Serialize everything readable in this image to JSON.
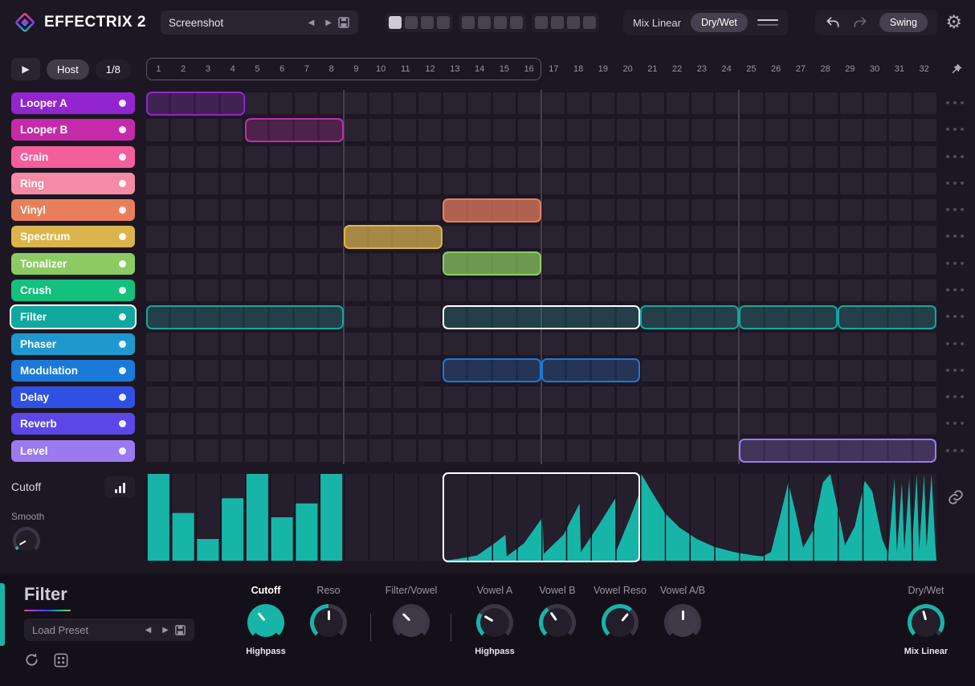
{
  "app": {
    "title": "EFFECTRIX 2"
  },
  "topbar": {
    "preset_name": "Screenshot",
    "pattern_slots": 12,
    "active_pattern": 1,
    "mix_label": "Mix Linear",
    "drywet_label": "Dry/Wet",
    "swing_label": "Swing"
  },
  "transport": {
    "host_label": "Host",
    "rate_label": "1/8"
  },
  "sequencer": {
    "steps": 32,
    "loop_steps": 16,
    "tracks": [
      {
        "name": "Looper A",
        "color": "#9325cf"
      },
      {
        "name": "Looper B",
        "color": "#c52ba8"
      },
      {
        "name": "Grain",
        "color": "#f55e9d"
      },
      {
        "name": "Ring",
        "color": "#f28ba3"
      },
      {
        "name": "Vinyl",
        "color": "#e87e5c"
      },
      {
        "name": "Spectrum",
        "color": "#dcb44c"
      },
      {
        "name": "Tonalizer",
        "color": "#8ccb61"
      },
      {
        "name": "Crush",
        "color": "#13c07c"
      },
      {
        "name": "Filter",
        "color": "#10a89e",
        "selected": true
      },
      {
        "name": "Phaser",
        "color": "#1f98cf"
      },
      {
        "name": "Modulation",
        "color": "#1b79da"
      },
      {
        "name": "Delay",
        "color": "#2f50e2"
      },
      {
        "name": "Reverb",
        "color": "#5b46e8"
      },
      {
        "name": "Level",
        "color": "#9b7af0"
      }
    ],
    "blocks": [
      {
        "track": 0,
        "start": 1,
        "end": 4,
        "fill": "dim"
      },
      {
        "track": 1,
        "start": 5,
        "end": 8,
        "fill": "dim"
      },
      {
        "track": 4,
        "start": 13,
        "end": 16,
        "fill": "solid"
      },
      {
        "track": 5,
        "start": 9,
        "end": 12,
        "fill": "solid"
      },
      {
        "track": 6,
        "start": 13,
        "end": 16,
        "fill": "solid"
      },
      {
        "track": 8,
        "start": 1,
        "end": 8,
        "fill": "dim"
      },
      {
        "track": 8,
        "start": 13,
        "end": 20,
        "fill": "dim",
        "selected": true
      },
      {
        "track": 8,
        "start": 21,
        "end": 24,
        "fill": "dim"
      },
      {
        "track": 8,
        "start": 25,
        "end": 28,
        "fill": "dim"
      },
      {
        "track": 8,
        "start": 29,
        "end": 32,
        "fill": "dim"
      },
      {
        "track": 10,
        "start": 13,
        "end": 16,
        "fill": "dim"
      },
      {
        "track": 10,
        "start": 17,
        "end": 20,
        "fill": "dim"
      },
      {
        "track": 13,
        "start": 25,
        "end": 32,
        "fill": "dim"
      }
    ]
  },
  "automation": {
    "param_label": "Cutoff",
    "smooth_label": "Smooth",
    "color": "#17b5a8",
    "selection": {
      "start": 13,
      "end": 20
    },
    "smooth_knob": {
      "value_deg": -120,
      "arc": 0.05
    },
    "bars": [
      {
        "step": 1,
        "h": 1.0
      },
      {
        "step": 2,
        "h": 0.55
      },
      {
        "step": 3,
        "h": 0.25
      },
      {
        "step": 4,
        "h": 0.72
      },
      {
        "step": 5,
        "h": 1.0
      },
      {
        "step": 6,
        "h": 0.5
      },
      {
        "step": 7,
        "h": 0.66
      },
      {
        "step": 8,
        "h": 1.0
      }
    ],
    "curve": [
      [
        12.05,
        0
      ],
      [
        12.6,
        0.02
      ],
      [
        13.4,
        0.06
      ],
      [
        14.2,
        0.22
      ],
      [
        14.55,
        0.3
      ],
      [
        14.6,
        0.05
      ],
      [
        15.3,
        0.2
      ],
      [
        16.05,
        0.5
      ],
      [
        16.1,
        0.08
      ],
      [
        16.9,
        0.3
      ],
      [
        17.55,
        0.66
      ],
      [
        17.6,
        0.1
      ],
      [
        18.3,
        0.4
      ],
      [
        19.0,
        0.72
      ],
      [
        19.05,
        0.12
      ],
      [
        19.6,
        0.5
      ],
      [
        20.0,
        0.8
      ],
      [
        20.02,
        0
      ],
      [
        20.05,
        1.0
      ],
      [
        20.5,
        0.78
      ],
      [
        21.0,
        0.55
      ],
      [
        21.6,
        0.38
      ],
      [
        22.3,
        0.25
      ],
      [
        23.0,
        0.16
      ],
      [
        23.8,
        0.1
      ],
      [
        24.6,
        0.06
      ],
      [
        24.95,
        0.05
      ],
      [
        25.3,
        0.1
      ],
      [
        25.7,
        0.55
      ],
      [
        26.0,
        0.9
      ],
      [
        26.3,
        0.55
      ],
      [
        26.6,
        0.15
      ],
      [
        27.0,
        0.35
      ],
      [
        27.4,
        0.9
      ],
      [
        27.7,
        1.0
      ],
      [
        28.0,
        0.6
      ],
      [
        28.3,
        0.18
      ],
      [
        28.7,
        0.4
      ],
      [
        29.1,
        0.92
      ],
      [
        29.4,
        0.8
      ],
      [
        29.8,
        0.25
      ],
      [
        30.05,
        0.08
      ],
      [
        30.2,
        0.6
      ],
      [
        30.3,
        0.95
      ],
      [
        30.4,
        0.1
      ],
      [
        30.6,
        0.9
      ],
      [
        30.7,
        0.12
      ],
      [
        30.9,
        0.95
      ],
      [
        31.0,
        0.12
      ],
      [
        31.2,
        1.0
      ],
      [
        31.3,
        0.12
      ],
      [
        31.5,
        1.0
      ],
      [
        31.6,
        0.15
      ],
      [
        31.8,
        1.0
      ],
      [
        31.95,
        0.2
      ],
      [
        32,
        0
      ]
    ]
  },
  "panel": {
    "title": "Filter",
    "accent": "#17b5a8",
    "load_preset_label": "Load Preset",
    "knobs": [
      {
        "label": "Cutoff",
        "sub": "Highpass",
        "value_deg": -40,
        "arc": 1,
        "filled": true
      },
      {
        "label": "Reso",
        "value_deg": 0,
        "arc": 0.5
      },
      {
        "label": "Filter/Vowel",
        "value_deg": -45,
        "arc": 0,
        "grey": true
      },
      {
        "label": "Vowel A",
        "sub": "Highpass",
        "value_deg": -60,
        "arc": 0.28
      },
      {
        "label": "Vowel B",
        "value_deg": -35,
        "arc": 0.37
      },
      {
        "label": "Vowel Reso",
        "value_deg": 40,
        "arc": 0.65
      },
      {
        "label": "Vowel A/B",
        "value_deg": 0,
        "arc": 0,
        "grey": true
      },
      {
        "label": "Dry/Wet",
        "sub": "Mix Linear",
        "value_deg": -15,
        "arc": 0.95
      }
    ]
  }
}
